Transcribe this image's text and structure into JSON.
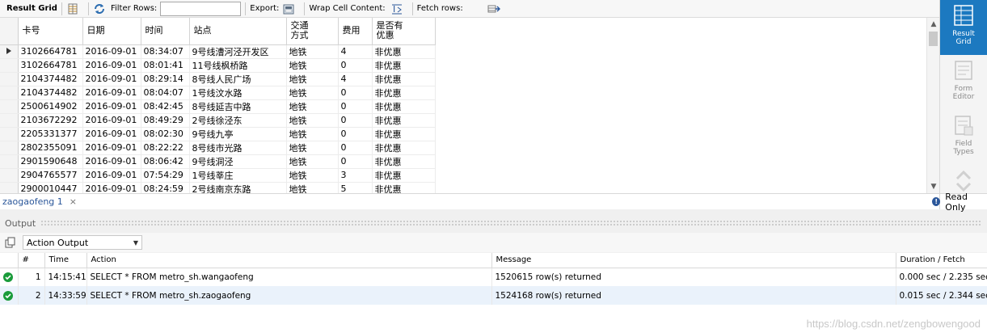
{
  "toolbar": {
    "result_grid_label": "Result Grid",
    "filter_rows_label": "Filter Rows:",
    "filter_rows_value": "",
    "export_label": "Export:",
    "wrap_cell_label": "Wrap Cell Content:",
    "fetch_rows_label": "Fetch rows:"
  },
  "grid": {
    "columns": [
      "卡号",
      "日期",
      "时间",
      "站点",
      "交通\n方式",
      "费用",
      "是否有\n优惠"
    ],
    "rows": [
      [
        "3102664781",
        "2016-09-01",
        "08:34:07",
        "9号线漕河泾开发区",
        "地铁",
        "4",
        "非优惠"
      ],
      [
        "3102664781",
        "2016-09-01",
        "08:01:41",
        "11号线枫桥路",
        "地铁",
        "0",
        "非优惠"
      ],
      [
        "2104374482",
        "2016-09-01",
        "08:29:14",
        "8号线人民广场",
        "地铁",
        "4",
        "非优惠"
      ],
      [
        "2104374482",
        "2016-09-01",
        "08:04:07",
        "1号线汶水路",
        "地铁",
        "0",
        "非优惠"
      ],
      [
        "2500614902",
        "2016-09-01",
        "08:42:45",
        "8号线延吉中路",
        "地铁",
        "0",
        "非优惠"
      ],
      [
        "2103672292",
        "2016-09-01",
        "08:49:29",
        "2号线徐泾东",
        "地铁",
        "0",
        "非优惠"
      ],
      [
        "2205331377",
        "2016-09-01",
        "08:02:30",
        "9号线九亭",
        "地铁",
        "0",
        "非优惠"
      ],
      [
        "2802355091",
        "2016-09-01",
        "08:22:22",
        "8号线市光路",
        "地铁",
        "0",
        "非优惠"
      ],
      [
        "2901590648",
        "2016-09-01",
        "08:06:42",
        "9号线洞泾",
        "地铁",
        "0",
        "非优惠"
      ],
      [
        "2904765577",
        "2016-09-01",
        "07:54:29",
        "1号线莘庄",
        "地铁",
        "3",
        "非优惠"
      ],
      [
        "2900010447",
        "2016-09-01",
        "08:24:59",
        "2号线南京东路",
        "地铁",
        "5",
        "非优惠"
      ]
    ]
  },
  "tab": {
    "label": "zaogaofeng 1",
    "close": "×"
  },
  "sidepanel": {
    "result_grid": "Result\nGrid",
    "form_editor": "Form\nEditor",
    "field_types": "Field\nTypes",
    "read_only": "Read Only"
  },
  "output": {
    "header": "Output",
    "select_value": "Action Output",
    "columns": [
      "",
      "#",
      "Time",
      "Action",
      "Message",
      "Duration / Fetch"
    ],
    "rows": [
      {
        "num": "1",
        "time": "14:15:41",
        "action": "SELECT * FROM metro_sh.wangaofeng",
        "message": "1520615 row(s) returned",
        "duration": "0.000 sec / 2.235 sec"
      },
      {
        "num": "2",
        "time": "14:33:59",
        "action": "SELECT * FROM metro_sh.zaogaofeng",
        "message": "1524168 row(s) returned",
        "duration": "0.015 sec / 2.344 sec"
      }
    ]
  },
  "watermark": "https://blog.csdn.net/zengbowengood"
}
